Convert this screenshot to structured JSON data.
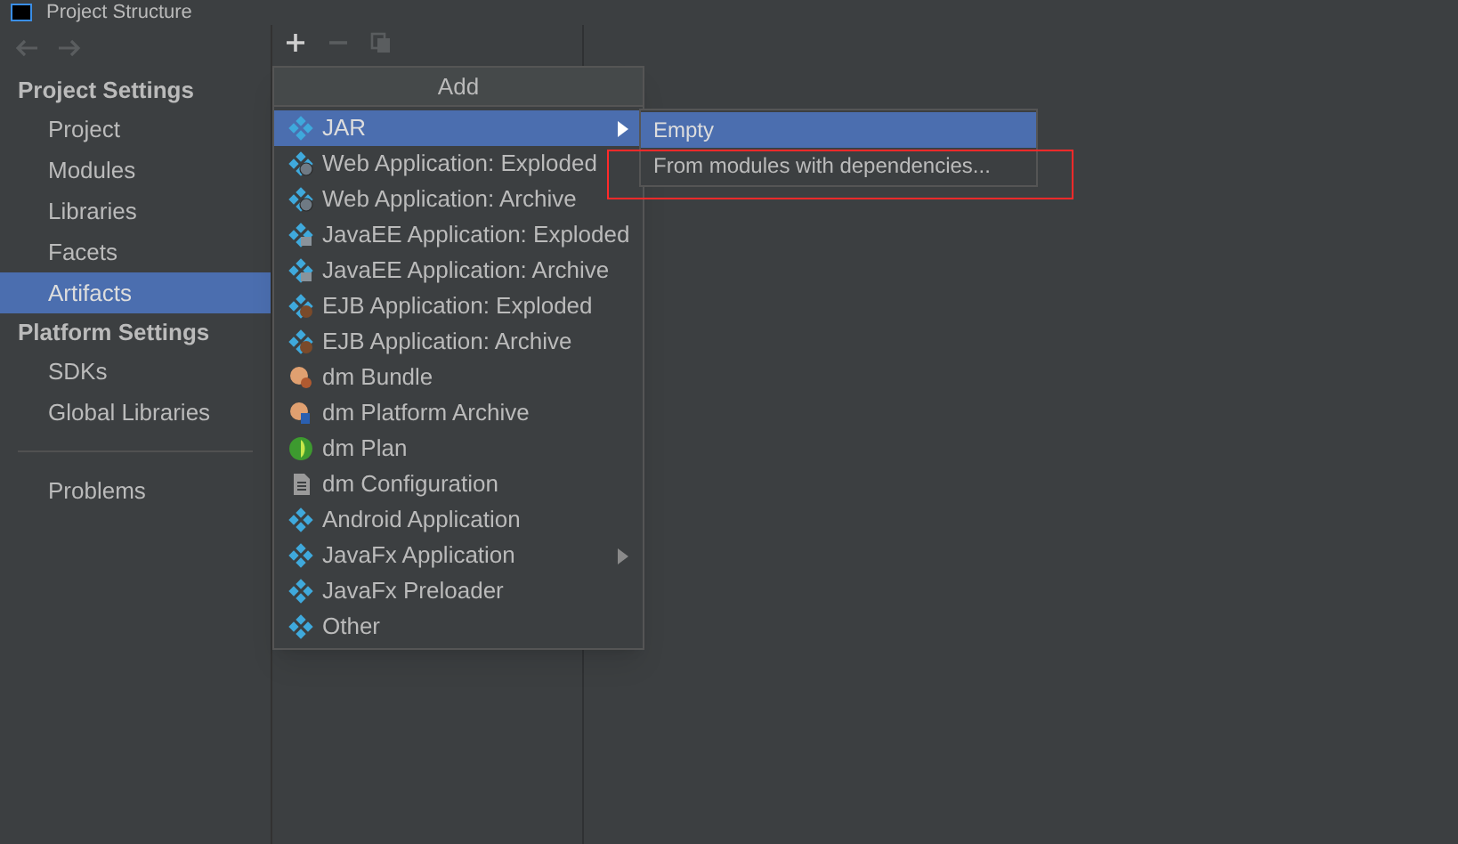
{
  "window": {
    "title": "Project Structure"
  },
  "sidebar": {
    "sections": [
      {
        "heading": "Project Settings",
        "items": [
          {
            "label": "Project",
            "selected": false
          },
          {
            "label": "Modules",
            "selected": false
          },
          {
            "label": "Libraries",
            "selected": false
          },
          {
            "label": "Facets",
            "selected": false
          },
          {
            "label": "Artifacts",
            "selected": true
          }
        ]
      },
      {
        "heading": "Platform Settings",
        "items": [
          {
            "label": "SDKs",
            "selected": false
          },
          {
            "label": "Global Libraries",
            "selected": false
          }
        ]
      }
    ],
    "footer_items": [
      {
        "label": "Problems",
        "selected": false
      }
    ]
  },
  "toolbar": {
    "buttons": [
      {
        "kind": "add",
        "disabled": false
      },
      {
        "kind": "remove",
        "disabled": true
      },
      {
        "kind": "copy",
        "disabled": true
      }
    ]
  },
  "add_menu": {
    "title": "Add",
    "items": [
      {
        "label": "JAR",
        "kind": "diamond",
        "submenu": true,
        "selected": true
      },
      {
        "label": "Web Application: Exploded",
        "kind": "web",
        "submenu": false,
        "selected": false
      },
      {
        "label": "Web Application: Archive",
        "kind": "web",
        "submenu": false,
        "selected": false
      },
      {
        "label": "JavaEE Application: Exploded",
        "kind": "javaee",
        "submenu": false,
        "selected": false
      },
      {
        "label": "JavaEE Application: Archive",
        "kind": "javaee",
        "submenu": false,
        "selected": false
      },
      {
        "label": "EJB Application: Exploded",
        "kind": "ejb",
        "submenu": false,
        "selected": false
      },
      {
        "label": "EJB Application: Archive",
        "kind": "ejb",
        "submenu": false,
        "selected": false
      },
      {
        "label": "dm Bundle",
        "kind": "bundle",
        "submenu": false,
        "selected": false
      },
      {
        "label": "dm Platform Archive",
        "kind": "platform",
        "submenu": false,
        "selected": false
      },
      {
        "label": "dm Plan",
        "kind": "plan",
        "submenu": false,
        "selected": false
      },
      {
        "label": "dm Configuration",
        "kind": "config",
        "submenu": false,
        "selected": false
      },
      {
        "label": "Android Application",
        "kind": "diamond",
        "submenu": false,
        "selected": false
      },
      {
        "label": "JavaFx Application",
        "kind": "diamond",
        "submenu": true,
        "selected": false
      },
      {
        "label": "JavaFx Preloader",
        "kind": "diamond",
        "submenu": false,
        "selected": false
      },
      {
        "label": "Other",
        "kind": "diamond",
        "submenu": false,
        "selected": false
      }
    ]
  },
  "jar_submenu": {
    "items": [
      {
        "label": "Empty",
        "selected": true,
        "highlighted": false
      },
      {
        "label": "From modules with dependencies...",
        "selected": false,
        "highlighted": true
      }
    ]
  }
}
